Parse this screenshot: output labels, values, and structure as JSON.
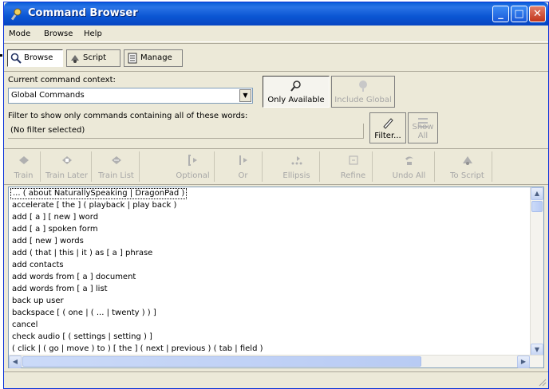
{
  "window": {
    "title": "Command Browser"
  },
  "menu": {
    "items": [
      "Mode",
      "Browse",
      "Help"
    ]
  },
  "tabs": [
    {
      "label": "Browse",
      "icon": "magnifier-icon",
      "active": true
    },
    {
      "label": "Script",
      "icon": "script-icon",
      "active": false
    },
    {
      "label": "Manage",
      "icon": "manage-icon",
      "active": false
    }
  ],
  "context": {
    "label": "Current command context:",
    "value": "Global Commands",
    "only_available": "Only Available",
    "include_global": "Include Global"
  },
  "filter": {
    "label": "Filter to show only commands containing all of these words:",
    "value": "(No filter selected)",
    "filter_button": "Filter...",
    "show_all_button": "Show All"
  },
  "toolbar": [
    {
      "label": "Train",
      "icon": "train-icon"
    },
    {
      "label": "Train Later",
      "icon": "train-later-icon"
    },
    {
      "label": "Train List",
      "icon": "train-list-icon"
    },
    {
      "label": "Optional",
      "icon": "optional-icon"
    },
    {
      "label": "Or",
      "icon": "or-icon"
    },
    {
      "label": "Ellipsis",
      "icon": "ellipsis-icon"
    },
    {
      "label": "Refine",
      "icon": "refine-icon"
    },
    {
      "label": "Undo All",
      "icon": "undo-all-icon"
    },
    {
      "label": "To Script",
      "icon": "to-script-icon"
    }
  ],
  "commands": [
    "... ( about NaturallySpeaking | DragonPad )",
    "accelerate [ the ] ( playback | play back )",
    "add [ a ] [ new ] word",
    "add [ a ] spoken form",
    "add [ new ] words",
    "add ( that | this | it ) as [ a ] phrase",
    "add contacts",
    "add words from [ a ] document",
    "add words from [ a ] list",
    "back up user",
    "backspace [ ( one | ( ... | twenty ) ) ]",
    "cancel",
    "check audio [ ( settings | setting ) ]",
    "( click | ( go | move ) to ) [ the ] ( next | previous ) ( tab | field )"
  ],
  "colors": {
    "titlebar": "#0a5fd8",
    "face": "#ece9d8",
    "disabled_text": "#a6a6a6"
  }
}
